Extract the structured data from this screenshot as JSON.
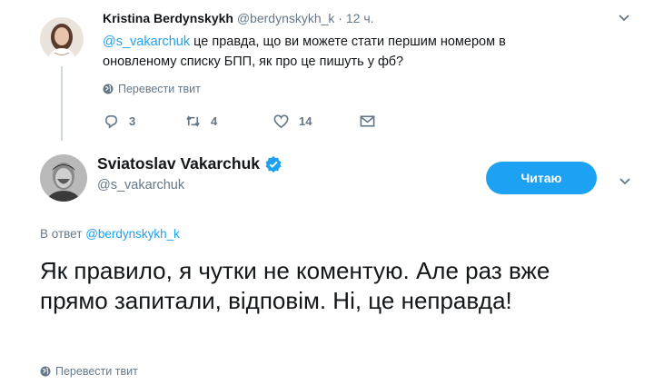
{
  "parent_tweet": {
    "author_name": "Kristina Berdynskykh",
    "author_handle": "@berdynskykh_k",
    "separator": "·",
    "time": "12 ч.",
    "mention": "@s_vakarchuk",
    "text": " це правда, що ви можете стати першим номером в оновленому списку БПП, як про це пишуть у фб?",
    "translate_label": "Перевести твит",
    "actions": {
      "reply_count": "3",
      "retweet_count": "4",
      "like_count": "14"
    }
  },
  "main_tweet": {
    "author_name": "Sviatoslav Vakarchuk",
    "verified_icon": "verified-badge-icon",
    "author_handle": "@s_vakarchuk",
    "follow_button_label": "Читаю",
    "reply_to_prefix": "В ответ",
    "reply_to_handle": "@berdynskykh_k",
    "text": "Як правило, я чутки не коментую. Але раз вже прямо запитали, відповім. Ні, це неправда!",
    "translate_label": "Перевести твит"
  },
  "icons": {
    "caret": "chevron-down-icon",
    "globe": "globe-icon",
    "reply": "reply-icon",
    "retweet": "retweet-icon",
    "like": "heart-icon",
    "dm": "envelope-icon"
  },
  "colors": {
    "accent": "#1da1f2",
    "text": "#14171a",
    "secondary": "#657786",
    "thread_line": "#cfd9de"
  }
}
